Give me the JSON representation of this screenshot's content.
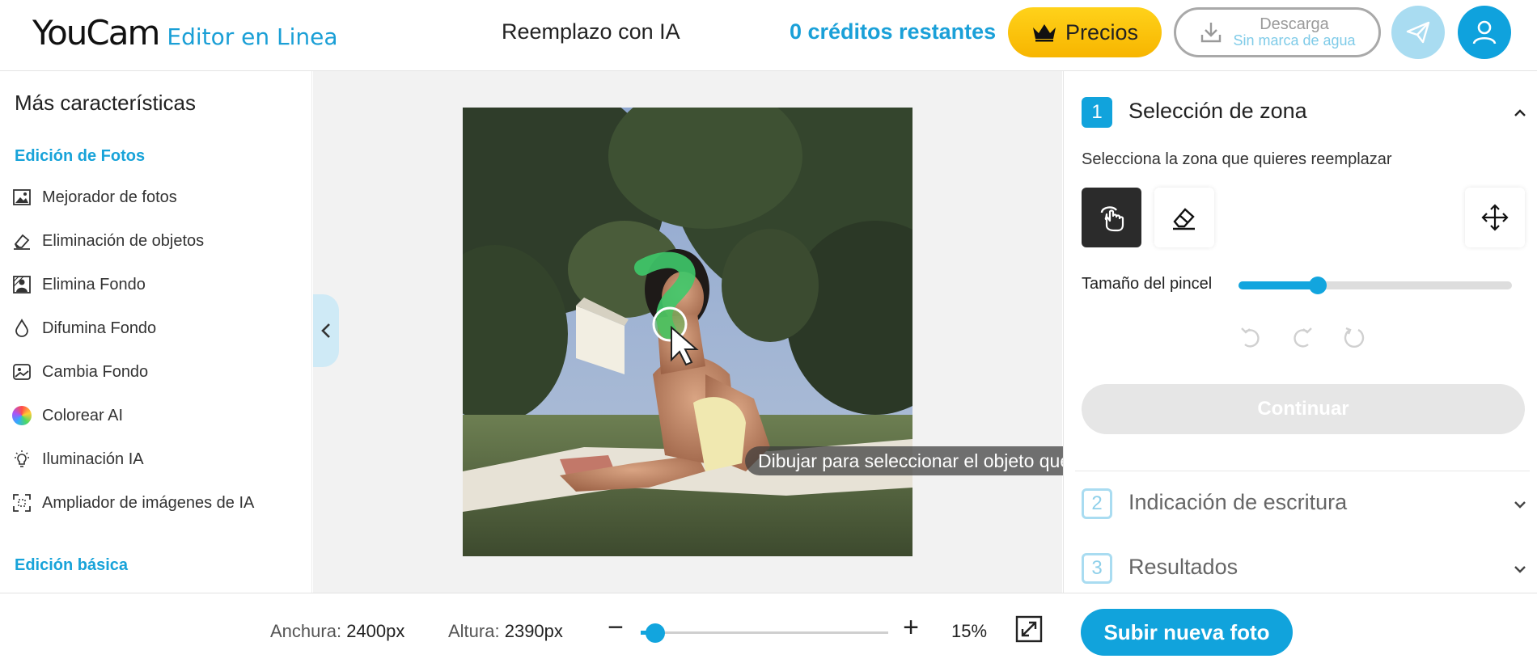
{
  "header": {
    "logo_main": "YouCam",
    "logo_sub": "Editor en Linea",
    "title": "Reemplazo con IA",
    "credits": "0 créditos restantes",
    "pricing_label": "Precios",
    "download_label": "Descarga",
    "download_sub": "Sin marca de agua",
    "icons": {
      "pricing": "crown-icon",
      "download": "download-icon",
      "send": "paper-plane-icon",
      "user": "user-icon"
    }
  },
  "sidebar": {
    "heading": "Más características",
    "section_photo": "Edición de Fotos",
    "items": [
      {
        "label": "Mejorador de fotos",
        "icon": "photo-enhance-icon"
      },
      {
        "label": "Eliminación de objetos",
        "icon": "eraser-icon"
      },
      {
        "label": "Elimina Fondo",
        "icon": "remove-background-icon"
      },
      {
        "label": "Difumina Fondo",
        "icon": "blur-drop-icon"
      },
      {
        "label": "Cambia Fondo",
        "icon": "change-background-icon"
      },
      {
        "label": "Colorear AI",
        "icon": "color-wheel-icon"
      },
      {
        "label": "Iluminación IA",
        "icon": "lightbulb-icon"
      },
      {
        "label": "Ampliador de imágenes de IA",
        "icon": "upscale-icon"
      }
    ],
    "section_basic": "Edición básica"
  },
  "canvas": {
    "hint": "Dibujar para seleccionar el objeto que desea sustituir"
  },
  "panel": {
    "step1": {
      "num": "1",
      "title": "Selección de zona"
    },
    "subtitle": "Selecciona la zona que quieres reemplazar",
    "brush_label": "Tamaño del pincel",
    "brush_size_fraction": 0.29,
    "continue_label": "Continuar",
    "step2": {
      "num": "2",
      "title": "Indicación de escritura"
    },
    "step3": {
      "num": "3",
      "title": "Resultados"
    }
  },
  "bottom": {
    "width_label": "Anchura:",
    "width_value": "2400px",
    "height_label": "Altura:",
    "height_value": "2390px",
    "zoom_minus": "−",
    "zoom_plus": "+",
    "zoom_fraction": 0.06,
    "zoom_percent": "15%",
    "upload_label": "Subir nueva foto"
  },
  "colors": {
    "accent": "#11a3dc",
    "pricing": "#ffc400",
    "brush_stroke": "#3ec96a"
  }
}
